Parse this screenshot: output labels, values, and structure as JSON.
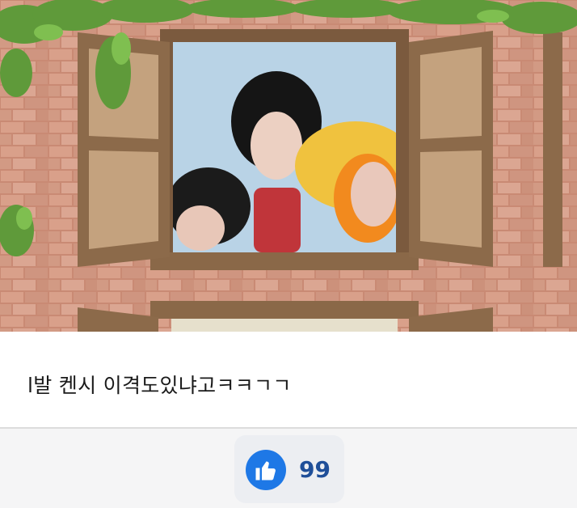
{
  "post": {
    "image": {
      "icon": "comic-window-illustration"
    },
    "caption": "l발 켄시 이격도있냐고ㅋㅋㄱㄱ"
  },
  "reactions": {
    "like_icon": "thumbs-up-icon",
    "like_count": "99",
    "accent_color": "#1e78e6"
  }
}
